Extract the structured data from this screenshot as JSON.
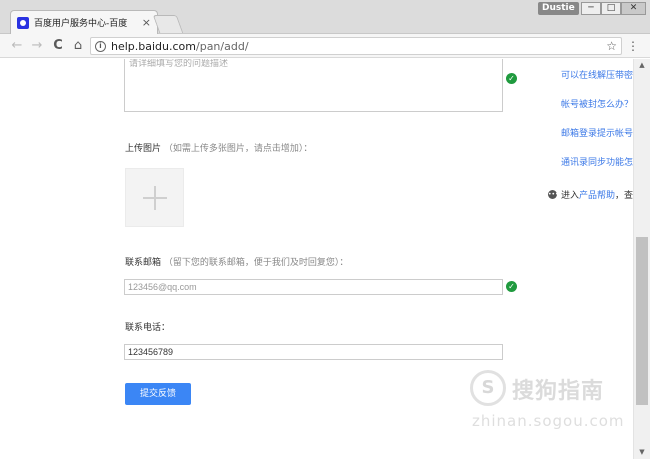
{
  "window": {
    "tab_title": "百度用户服务中心-百度",
    "tab_close": "×",
    "user_badge": "Dustie",
    "minimize": "─",
    "maximize": "□",
    "close": "✕"
  },
  "toolbar": {
    "back": "←",
    "forward": "→",
    "reload": "C",
    "home": "⌂",
    "url_host": "help.baidu.com",
    "url_path": "/pan/add/",
    "star": "☆",
    "menu": "⋮"
  },
  "form": {
    "description_placeholder": "请详细填写您的问题描述",
    "upload_label": "上传图片",
    "upload_hint": "（如需上传多张图片，请点击增加）：",
    "email_label": "联系邮箱",
    "email_hint": "（留下您的联系邮箱，便于我们及时回复您）：",
    "email_value": "123456@qq.com",
    "phone_label": "联系电话：",
    "phone_value": "123456789",
    "submit_label": "提交反馈"
  },
  "sidebar": {
    "links": [
      "可以在线解压带密码",
      "帐号被封怎么办？",
      "邮箱登录提示帐号不",
      "通讯录同步功能怎么"
    ],
    "help_prefix": "进入",
    "help_link": "产品帮助",
    "help_suffix": "，查看"
  },
  "watermark": {
    "logo": "S",
    "name": "搜狗指南",
    "domain": "zhinan.sogou.com"
  },
  "colors": {
    "accent": "#3b86f5",
    "link": "#3b78e7",
    "success": "#1f9a3e"
  }
}
